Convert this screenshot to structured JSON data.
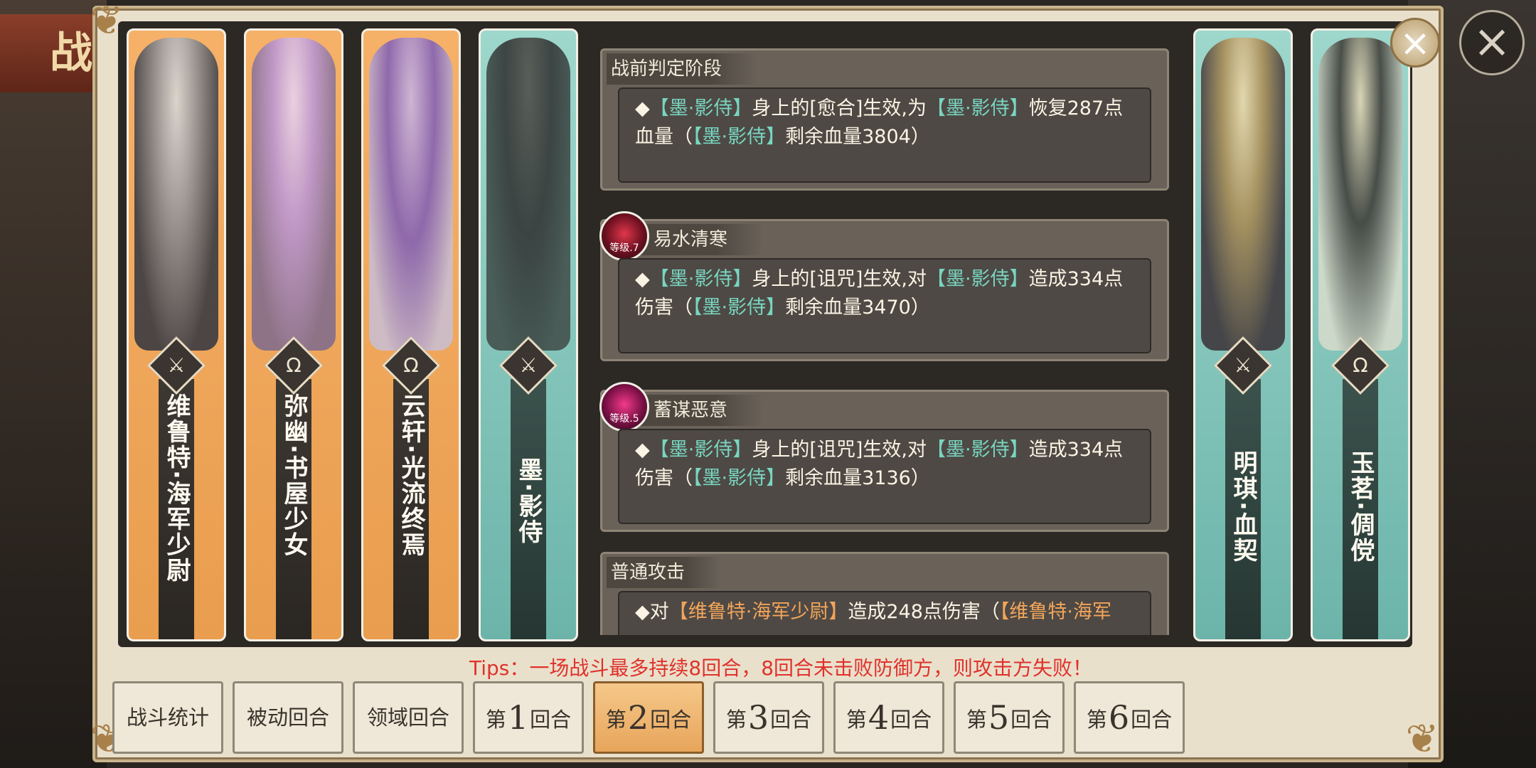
{
  "background_banner": "战",
  "characters_left": [
    {
      "name": "维鲁特·海军少尉",
      "role_icon": "crossed-swords-icon",
      "color": "orange"
    },
    {
      "name": "弥幽·书屋少女",
      "role_icon": "omega-icon",
      "color": "orange"
    },
    {
      "name": "云轩·光流终焉",
      "role_icon": "omega-icon",
      "color": "orange"
    },
    {
      "name": "墨·影侍",
      "role_icon": "crossed-swords-icon",
      "color": "teal"
    }
  ],
  "characters_right": [
    {
      "name": "明琪·血契",
      "role_icon": "crossed-swords-icon",
      "color": "teal"
    },
    {
      "name": "玉茗·倜傥",
      "role_icon": "omega-icon",
      "color": "teal"
    }
  ],
  "log": {
    "s1": {
      "title": "战前判定阶段",
      "parts": [
        "◆",
        "【墨·影侍】",
        "身上的[愈合]生效,为",
        "【墨·影侍】",
        "恢复287点血量（",
        "【墨·影侍】",
        "剩余血量3804）"
      ]
    },
    "s2": {
      "title": "易水清寒",
      "level": "等级.7",
      "parts": [
        "◆",
        "【墨·影侍】",
        "身上的[诅咒]生效,对",
        "【墨·影侍】",
        "造成334点伤害（",
        "【墨·影侍】",
        "剩余血量3470）"
      ]
    },
    "s3": {
      "title": "蓄谋恶意",
      "level": "等级.5",
      "parts": [
        "◆",
        "【墨·影侍】",
        "身上的[诅咒]生效,对",
        "【墨·影侍】",
        "造成334点伤害（",
        "【墨·影侍】",
        "剩余血量3136）"
      ]
    },
    "s4": {
      "title": "普通攻击",
      "parts": [
        "◆对",
        "【维鲁特·海军少尉】",
        "造成248点伤害（",
        "【维鲁特·海军"
      ]
    }
  },
  "tips": "Tips：一场战斗最多持续8回合，8回合未击败防御方，则攻击方失败！",
  "buttons": {
    "stats": "战斗统计",
    "passive": "被动回合",
    "domain": "领域回合",
    "round_prefix": "第",
    "round_suffix": "回合",
    "rounds": [
      "1",
      "2",
      "3",
      "4",
      "5",
      "6"
    ],
    "active_round": "2"
  },
  "colors": {
    "teal_name": "#78d6c0",
    "orange_name": "#f2a55a",
    "tips": "#e0322b",
    "active_button": "#f0b46e"
  },
  "icons": {
    "panel_close": "close-icon",
    "outer_close": "close-icon"
  }
}
